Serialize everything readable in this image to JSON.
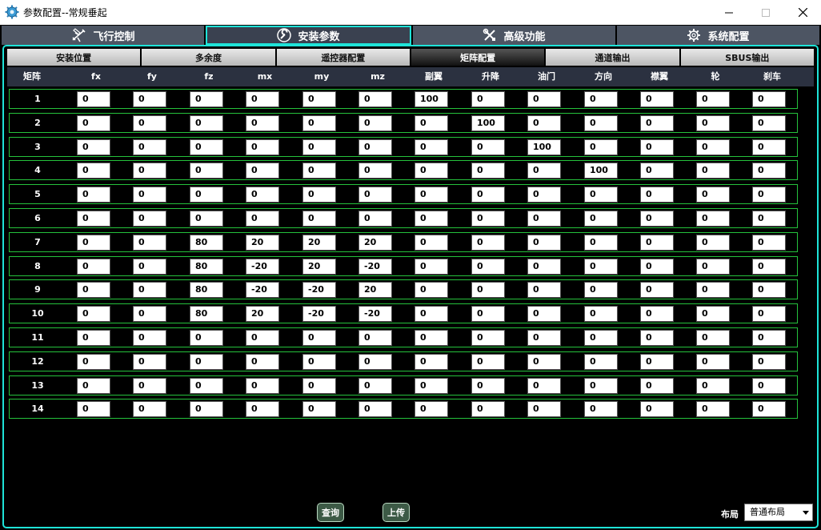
{
  "window": {
    "title": "参数配置--常规垂起"
  },
  "main_tabs": [
    {
      "label": "飞行控制",
      "icon": "plane-icon"
    },
    {
      "label": "安装参数",
      "icon": "wrench-icon"
    },
    {
      "label": "高级功能",
      "icon": "tools-icon"
    },
    {
      "label": "系统配置",
      "icon": "gear-icon"
    }
  ],
  "sub_tabs": [
    "安装位置",
    "多余度",
    "遥控器配置",
    "矩阵配置",
    "通道输出",
    "SBUS输出"
  ],
  "columns": [
    "矩阵",
    "fx",
    "fy",
    "fz",
    "mx",
    "my",
    "mz",
    "副翼",
    "升降",
    "油门",
    "方向",
    "襟翼",
    "轮",
    "刹车"
  ],
  "rows": [
    {
      "label": "1",
      "values": [
        "0",
        "0",
        "0",
        "0",
        "0",
        "0",
        "100",
        "0",
        "0",
        "0",
        "0",
        "0",
        "0"
      ]
    },
    {
      "label": "2",
      "values": [
        "0",
        "0",
        "0",
        "0",
        "0",
        "0",
        "0",
        "100",
        "0",
        "0",
        "0",
        "0",
        "0"
      ]
    },
    {
      "label": "3",
      "values": [
        "0",
        "0",
        "0",
        "0",
        "0",
        "0",
        "0",
        "0",
        "100",
        "0",
        "0",
        "0",
        "0"
      ]
    },
    {
      "label": "4",
      "values": [
        "0",
        "0",
        "0",
        "0",
        "0",
        "0",
        "0",
        "0",
        "0",
        "100",
        "0",
        "0",
        "0"
      ]
    },
    {
      "label": "5",
      "values": [
        "0",
        "0",
        "0",
        "0",
        "0",
        "0",
        "0",
        "0",
        "0",
        "0",
        "0",
        "0",
        "0"
      ]
    },
    {
      "label": "6",
      "values": [
        "0",
        "0",
        "0",
        "0",
        "0",
        "0",
        "0",
        "0",
        "0",
        "0",
        "0",
        "0",
        "0"
      ]
    },
    {
      "label": "7",
      "values": [
        "0",
        "0",
        "80",
        "20",
        "20",
        "20",
        "0",
        "0",
        "0",
        "0",
        "0",
        "0",
        "0"
      ]
    },
    {
      "label": "8",
      "values": [
        "0",
        "0",
        "80",
        "-20",
        "20",
        "-20",
        "0",
        "0",
        "0",
        "0",
        "0",
        "0",
        "0"
      ]
    },
    {
      "label": "9",
      "values": [
        "0",
        "0",
        "80",
        "-20",
        "-20",
        "20",
        "0",
        "0",
        "0",
        "0",
        "0",
        "0",
        "0"
      ]
    },
    {
      "label": "10",
      "values": [
        "0",
        "0",
        "80",
        "20",
        "-20",
        "-20",
        "0",
        "0",
        "0",
        "0",
        "0",
        "0",
        "0"
      ]
    },
    {
      "label": "11",
      "values": [
        "0",
        "0",
        "0",
        "0",
        "0",
        "0",
        "0",
        "0",
        "0",
        "0",
        "0",
        "0",
        "0"
      ]
    },
    {
      "label": "12",
      "values": [
        "0",
        "0",
        "0",
        "0",
        "0",
        "0",
        "0",
        "0",
        "0",
        "0",
        "0",
        "0",
        "0"
      ]
    },
    {
      "label": "13",
      "values": [
        "0",
        "0",
        "0",
        "0",
        "0",
        "0",
        "0",
        "0",
        "0",
        "0",
        "0",
        "0",
        "0"
      ]
    },
    {
      "label": "14",
      "values": [
        "0",
        "0",
        "0",
        "0",
        "0",
        "0",
        "0",
        "0",
        "0",
        "0",
        "0",
        "0",
        "0"
      ]
    }
  ],
  "buttons": {
    "query": "查询",
    "upload": "上传"
  },
  "layout": {
    "label": "布局",
    "selected": "普通布局"
  },
  "colors": {
    "accent": "#1ee3d8",
    "row_border": "#25c23c",
    "tab": "#4d5563"
  }
}
